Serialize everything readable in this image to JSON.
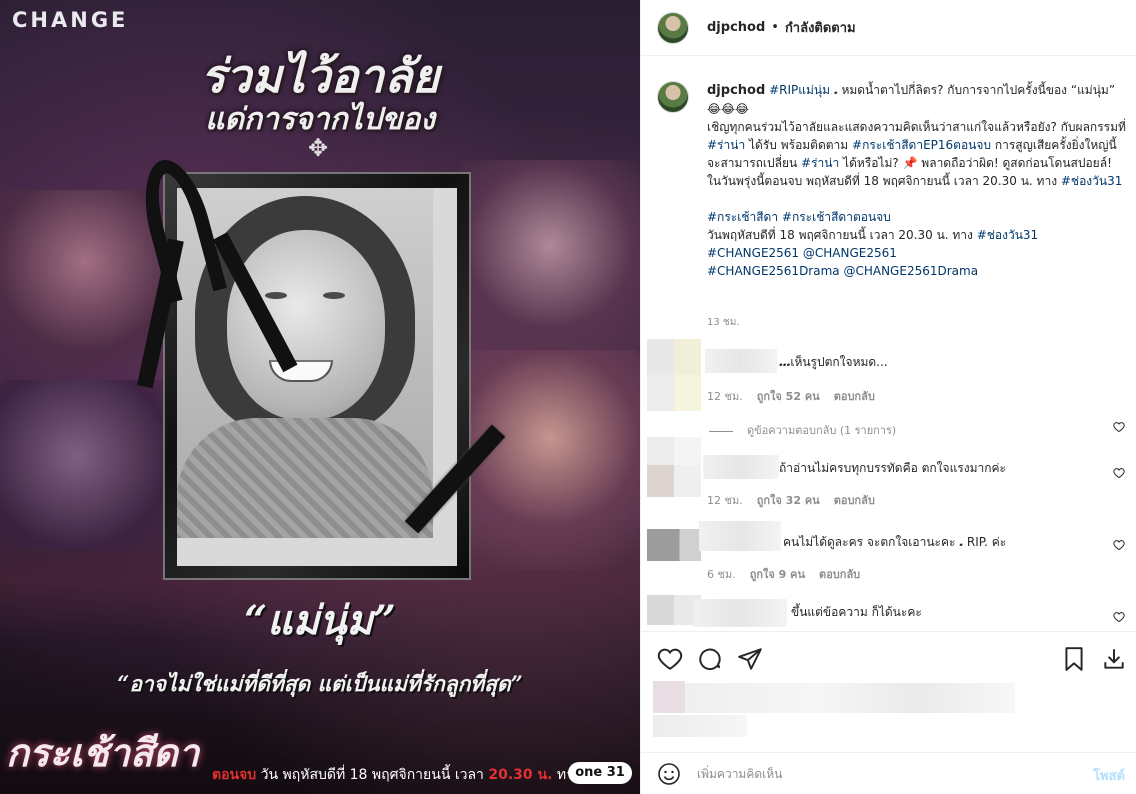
{
  "media": {
    "brand": "CHANGE",
    "headline_1": "ร่วมไว้อาลัย",
    "headline_2": "แด่การจากไปของ",
    "name_quote": "“แม่นุ่ม”",
    "tagline": "“อาจไม่ใช่แม่ที่ดีที่สุด แต่เป็นแม่ที่รักลูกที่สุด”",
    "show_title": "กระเช้าสีดา",
    "airing_prefix": "ตอนจบ",
    "airing_text": "วัน พฤหัสบดีที่ 18 พฤศจิกายนนี้ เวลา",
    "airing_time": "20.30 น.",
    "airing_suffix": "ทาง",
    "channel_logo": "one 31"
  },
  "header": {
    "username": "djpchod",
    "separator": "•",
    "follow_label": "กำลังติดตาม"
  },
  "caption": {
    "username": "djpchod",
    "para1_a": " ",
    "hashtag_rip": "#RIPแม่นุ่ม",
    "para1_b": " 𝅘 หมดน้ำตาไปกี่ลิตร? กับการจากไปครั้งนี้ของ “แม่นุ่ม” 😂😂😂",
    "para2_a": "เชิญทุกคนร่วมไว้อาลัยและแสดงความคิดเห็นว่าสาแก่ใจแล้วหรือยัง? กับผลกรรมที่ ",
    "hashtag_ramna": "#ร่าน่า",
    "para2_b": " ได้รับ พร้อมติดตาม ",
    "hashtag_ep16": "#กระเช้าสีดาEP16ตอนจบ",
    "para2_c": " การสูญเสียครั้งยิ่งใหญ่นี้ จะสามารถเปลี่ยน ",
    "hashtag_ramna2": "#ร่าน่า",
    "para2_d": " ได้หรือไม่? 📌 พลาดถือว่าผิด! ดูสดก่อนโดนสปอยล์! ในวันพรุ่งนี้ตอนจบ พฤหัสบดีที่ 18 พฤศจิกายนนี้ เวลา 20.30 น. ทาง ",
    "hashtag_ch31": "#ช่องวัน31",
    "tags_line1_a": "#กระเช้าสีดา",
    "tags_line1_b": "#กระเช้าสีดาตอนจบ",
    "line_date": "วันพฤหัสบดีที่ 18 พฤศจิกายนนี้ เวลา 20.30 น. ทาง ",
    "line_date_tag": "#ช่องวัน31",
    "tag_change": "#CHANGE2561",
    "mention_change": "@CHANGE2561",
    "tag_drama": "#CHANGE2561Drama",
    "mention_drama": "@CHANGE2561Drama",
    "time": "13 ชม."
  },
  "comments": [
    {
      "text": "𝅘𝅘𝅘เห็นรูปตกใจหมด...",
      "time": "12 ชม.",
      "likes": "ถูกใจ 52 คน",
      "reply": "ตอบกลับ",
      "view_replies": "ดูข้อความตอบกลับ (1 รายการ)"
    },
    {
      "text": "ถ้าอ่านไม่ครบทุกบรรทัดคือ ตกใจแรงมากค่ะ",
      "time": "12 ชม.",
      "likes": "ถูกใจ 32 คน",
      "reply": "ตอบกลับ"
    },
    {
      "text": "คนไม่ได้ดูละคร จะตกใจเอานะคะ 𝅘 RIP. ค่ะ",
      "time": "6 ชม.",
      "likes": "ถูกใจ 9 คน",
      "reply": "ตอบกลับ"
    },
    {
      "text": "ขึ้นแต่ข้อความ ก็ได้นะคะ"
    }
  ],
  "composer": {
    "placeholder": "เพิ่มความคิดเห็น",
    "post_label": "โพสต์"
  },
  "colors": {
    "link": "#00376b",
    "post_disabled": "#b2dffc",
    "meta": "#8e8e8e"
  }
}
